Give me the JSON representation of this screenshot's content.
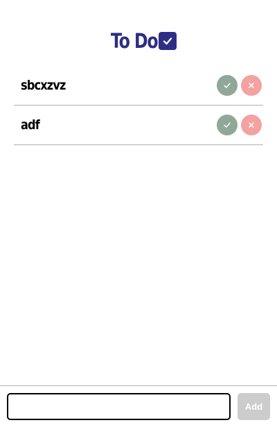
{
  "header": {
    "title": "To Do",
    "icon": "checkbox-checked-icon",
    "color": "#2e2e85"
  },
  "todos": [
    {
      "text": "sbcxzvz",
      "done_icon": "checkmark-icon",
      "remove_icon": "close-icon"
    },
    {
      "text": "adf",
      "done_icon": "checkmark-icon",
      "remove_icon": "close-icon"
    }
  ],
  "composer": {
    "input_value": "",
    "add_label": "Add"
  },
  "colors": {
    "done": "#8fa89a",
    "remove": "#f3a2a2",
    "add_button": "#cccccc"
  }
}
